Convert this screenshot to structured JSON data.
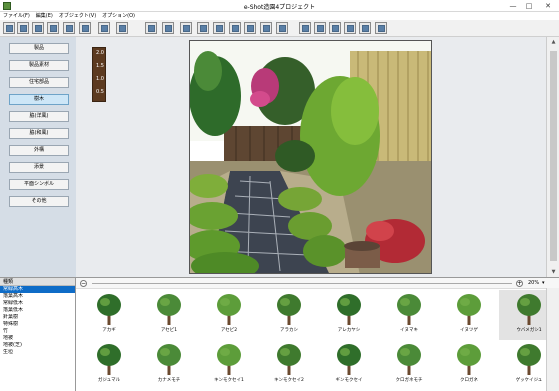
{
  "window": {
    "title": "e-Shot造園4プロジェクト"
  },
  "window_controls": {
    "minimize": "—",
    "maximize": "□",
    "close": "✕"
  },
  "menu": [
    "ファイル(F)",
    "編集(E)",
    "オブジェクト(V)",
    "オプション(O)"
  ],
  "toolbar_icons": [
    "new-icon",
    "open-icon",
    "save-icon",
    "print-icon",
    "camera-icon",
    "tree-icon",
    "bush-icon",
    "pot-icon",
    "cursor-icon",
    "move-icon",
    "rotate-left-icon",
    "rotate-right-icon",
    "flip-icon",
    "layer-icon",
    "zoom-icon",
    "select-icon",
    "group-icon",
    "align-left-icon",
    "align-center-icon",
    "align-right-icon",
    "align-bottom-icon",
    "grid-icon",
    "help-icon"
  ],
  "categories": [
    {
      "label": "製品",
      "active": false
    },
    {
      "label": "製品素材",
      "active": false
    },
    {
      "label": "住宅部品",
      "active": false
    },
    {
      "label": "樹木",
      "active": true
    },
    {
      "label": "脇(洋風)",
      "active": false
    },
    {
      "label": "脇(和風)",
      "active": false
    },
    {
      "label": "外構",
      "active": false
    },
    {
      "label": "添景",
      "active": false
    },
    {
      "label": "平面シンボル",
      "active": false
    },
    {
      "label": "その他",
      "active": false
    }
  ],
  "scale": {
    "labels": [
      "2.0",
      "1.5",
      "1.0",
      "0.5"
    ]
  },
  "type_list": {
    "header": "種類",
    "items": [
      {
        "label": "常緑高木",
        "selected": true
      },
      {
        "label": "落葉高木",
        "selected": false
      },
      {
        "label": "常緑低木",
        "selected": false
      },
      {
        "label": "落葉低木",
        "selected": false
      },
      {
        "label": "針葉樹",
        "selected": false
      },
      {
        "label": "特殊樹",
        "selected": false
      },
      {
        "label": "竹",
        "selected": false
      },
      {
        "label": "地被",
        "selected": false
      },
      {
        "label": "地被(芝)",
        "selected": false
      },
      {
        "label": "生垣",
        "selected": false
      }
    ]
  },
  "catalog": {
    "zoom_value": "20%",
    "zoom_minus": "−",
    "zoom_plus": "+",
    "dropdown": "▾",
    "trees": [
      {
        "name": "アカギ",
        "icon": "tree-icon",
        "selected": false
      },
      {
        "name": "アセビ1",
        "icon": "tree-icon",
        "selected": false
      },
      {
        "name": "アセビ2",
        "icon": "tree-icon",
        "selected": false
      },
      {
        "name": "アラカシ",
        "icon": "tree-icon",
        "selected": false
      },
      {
        "name": "アレカヤシ",
        "icon": "tree-icon",
        "selected": false
      },
      {
        "name": "イヌマキ",
        "icon": "tree-icon",
        "selected": false
      },
      {
        "name": "イヌツゲ",
        "icon": "tree-icon",
        "selected": false
      },
      {
        "name": "ウバメガシ1",
        "icon": "tree-icon",
        "selected": true
      },
      {
        "name": "ガジュマル",
        "icon": "tree-icon",
        "selected": false
      },
      {
        "name": "カナメモチ",
        "icon": "tree-icon",
        "selected": false
      },
      {
        "name": "キンモクセイ1",
        "icon": "tree-icon",
        "selected": false
      },
      {
        "name": "キンモクセイ2",
        "icon": "tree-icon",
        "selected": false
      },
      {
        "name": "ギンモクセイ",
        "icon": "tree-icon",
        "selected": false
      },
      {
        "name": "クロガネモチ",
        "icon": "tree-icon",
        "selected": false
      },
      {
        "name": "クロガネ",
        "icon": "tree-icon",
        "selected": false
      },
      {
        "name": "ゲッケイジュ",
        "icon": "tree-icon",
        "selected": false
      }
    ]
  },
  "colors": {
    "accent": "#0f6cc7",
    "sidebar": "#d5dde6",
    "workarea": "#e9ebee",
    "bamboo": "#c9b978"
  }
}
